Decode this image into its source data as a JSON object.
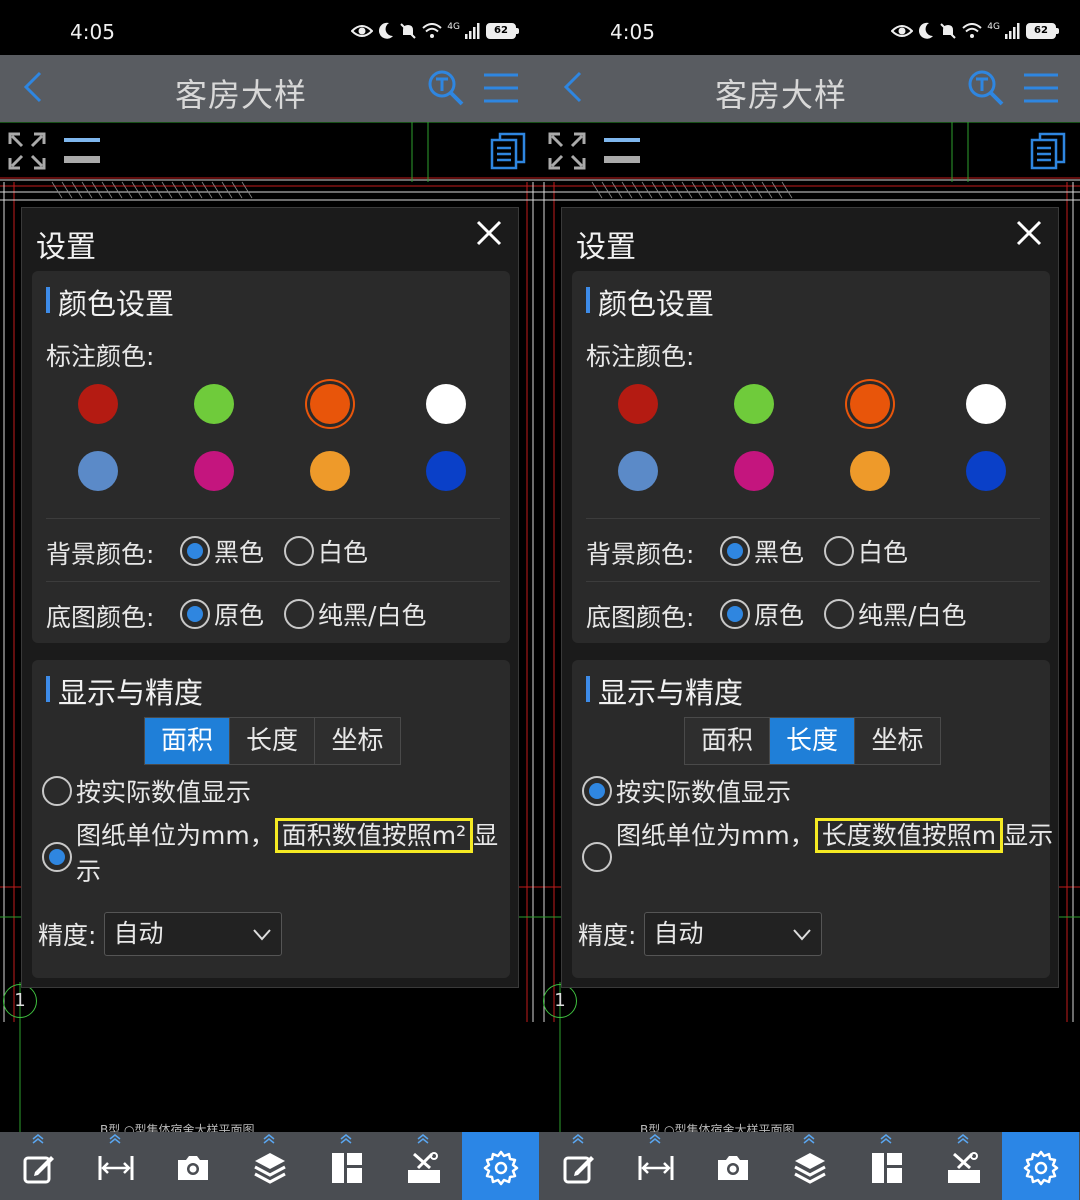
{
  "screens": [
    {
      "status": {
        "time": "4:05",
        "network": "4G",
        "battery": "62"
      },
      "header": {
        "title": "客房大样"
      },
      "settings": {
        "title": "设置",
        "color_section": {
          "heading": "颜色设置",
          "annot_label": "标注颜色:",
          "swatches": [
            "#b41b12",
            "#6fcb3b",
            "#e8550a",
            "#ffffff",
            "#5b8ac8",
            "#c4157e",
            "#ee9a2a",
            "#0a40c8"
          ],
          "selected_swatch": "#e8550a",
          "bg_label": "背景颜色:",
          "bg_options": [
            "黑色",
            "白色"
          ],
          "bg_selected": "黑色",
          "base_label": "底图颜色:",
          "base_options": [
            "原色",
            "纯黑/白色"
          ],
          "base_selected": "原色"
        },
        "display_section": {
          "heading": "显示与精度",
          "tabs": [
            "面积",
            "长度",
            "坐标"
          ],
          "active_tab": "面积",
          "option1": "按实际数值显示",
          "option2_prefix": "图纸单位为mm，",
          "option2_highlight": "面积数值按照m²",
          "option2_suffix": "显示",
          "selected_option": "option2",
          "precision_label": "精度:",
          "precision_value": "自动"
        }
      },
      "drawing": {
        "axis_label": "1",
        "sheet_text": "B型 ○型集体宿舍大样平面图"
      },
      "toolbar": [
        "edit-icon",
        "measure-icon",
        "camera-icon",
        "layers-icon",
        "layout-icon",
        "tools-icon",
        "settings-icon"
      ]
    },
    {
      "status": {
        "time": "4:05",
        "network": "4G",
        "battery": "62"
      },
      "header": {
        "title": "客房大样"
      },
      "settings": {
        "title": "设置",
        "color_section": {
          "heading": "颜色设置",
          "annot_label": "标注颜色:",
          "swatches": [
            "#b41b12",
            "#6fcb3b",
            "#e8550a",
            "#ffffff",
            "#5b8ac8",
            "#c4157e",
            "#ee9a2a",
            "#0a40c8"
          ],
          "selected_swatch": "#e8550a",
          "bg_label": "背景颜色:",
          "bg_options": [
            "黑色",
            "白色"
          ],
          "bg_selected": "黑色",
          "base_label": "底图颜色:",
          "base_options": [
            "原色",
            "纯黑/白色"
          ],
          "base_selected": "原色"
        },
        "display_section": {
          "heading": "显示与精度",
          "tabs": [
            "面积",
            "长度",
            "坐标"
          ],
          "active_tab": "长度",
          "option1": "按实际数值显示",
          "option2_prefix": "图纸单位为mm，",
          "option2_highlight": "长度数值按照m",
          "option2_suffix": "显示",
          "selected_option": "option1",
          "precision_label": "精度:",
          "precision_value": "自动"
        }
      },
      "drawing": {
        "axis_label": "1",
        "sheet_text": "B型 ○型集体宿舍大样平面图"
      },
      "toolbar": [
        "edit-icon",
        "measure-icon",
        "camera-icon",
        "layers-icon",
        "layout-icon",
        "tools-icon",
        "settings-icon"
      ]
    }
  ]
}
